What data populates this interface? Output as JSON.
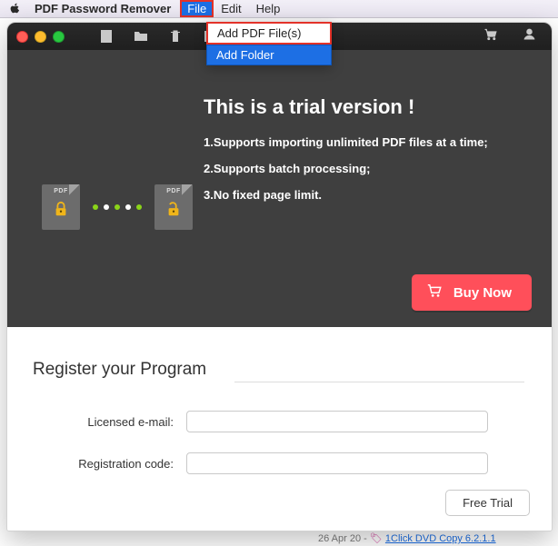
{
  "menubar": {
    "app_name": "PDF Password Remover",
    "file": "File",
    "edit": "Edit",
    "help": "Help"
  },
  "dropdown": {
    "add_files": "Add PDF File(s)",
    "add_folder": "Add Folder"
  },
  "hero": {
    "title": "This is a trial version !",
    "line1": "1.Supports importing unlimited PDF files at a time;",
    "line2": "2.Supports batch processing;",
    "line3": "3.No fixed page limit.",
    "pdf_label": "PDF",
    "buy_now": "Buy Now"
  },
  "register": {
    "heading": "Register your Program",
    "email_label": "Licensed e-mail:",
    "code_label": "Registration code:",
    "email_value": "",
    "code_value": "",
    "free_trial": "Free Trial"
  },
  "dots": [
    "#8bd419",
    "#fff",
    "#8bd419",
    "#fff",
    "#8bd419"
  ],
  "behind": {
    "date": "26 Apr 20 - ",
    "link": "1Click DVD Copy 6.2.1.1"
  }
}
